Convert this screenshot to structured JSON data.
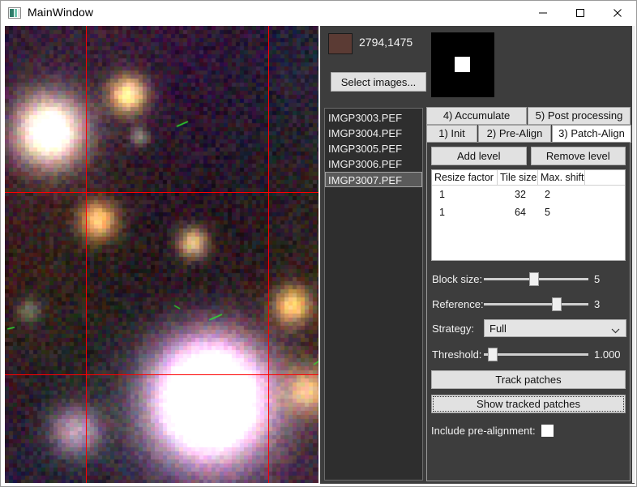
{
  "window": {
    "title": "MainWindow",
    "icon": "picture-icon",
    "controls": {
      "minimize": "—",
      "maximize": "□",
      "close": "✕"
    }
  },
  "preview": {
    "name": "image-preview",
    "crosshair_color": "#fe0000",
    "vlines": [
      100,
      325
    ],
    "hlines": [
      205,
      430
    ]
  },
  "info": {
    "swatch_color": "#5b3b34",
    "coordinates": "2794,1475",
    "select_images_label": "Select images...",
    "thumbnail": {
      "background": "#000000",
      "marker_color": "#ffffff"
    }
  },
  "file_list": {
    "items": [
      {
        "label": "IMGP3003.PEF",
        "selected": false
      },
      {
        "label": "IMGP3004.PEF",
        "selected": false
      },
      {
        "label": "IMGP3005.PEF",
        "selected": false
      },
      {
        "label": "IMGP3006.PEF",
        "selected": false
      },
      {
        "label": "IMGP3007.PEF",
        "selected": true
      }
    ]
  },
  "tabs": {
    "row1": [
      {
        "label": "4) Accumulate",
        "active": false
      },
      {
        "label": "5) Post processing",
        "active": false
      }
    ],
    "row2": [
      {
        "label": "1) Init",
        "active": false
      },
      {
        "label": "2) Pre-Align",
        "active": false
      },
      {
        "label": "3) Patch-Align",
        "active": true
      }
    ]
  },
  "patch_align": {
    "add_level_label": "Add level",
    "remove_level_label": "Remove level",
    "table": {
      "headers": [
        "Resize factor",
        "Tile size",
        "Max. shift",
        ""
      ],
      "rows": [
        [
          "1",
          "32",
          "2",
          ""
        ],
        [
          "1",
          "64",
          "5",
          ""
        ]
      ]
    },
    "block_size": {
      "label": "Block size:",
      "value": "5",
      "fill_pct": 48
    },
    "reference": {
      "label": "Reference:",
      "value": "3",
      "fill_pct": 72
    },
    "strategy": {
      "label": "Strategy:",
      "value": "Full"
    },
    "threshold": {
      "label": "Threshold:",
      "value": "1.000",
      "fill_pct": 4
    },
    "track_patches_label": "Track patches",
    "show_tracked_patches_label": "Show tracked patches",
    "include_prealignment_label": "Include pre-alignment:",
    "include_prealignment_checked": false
  }
}
